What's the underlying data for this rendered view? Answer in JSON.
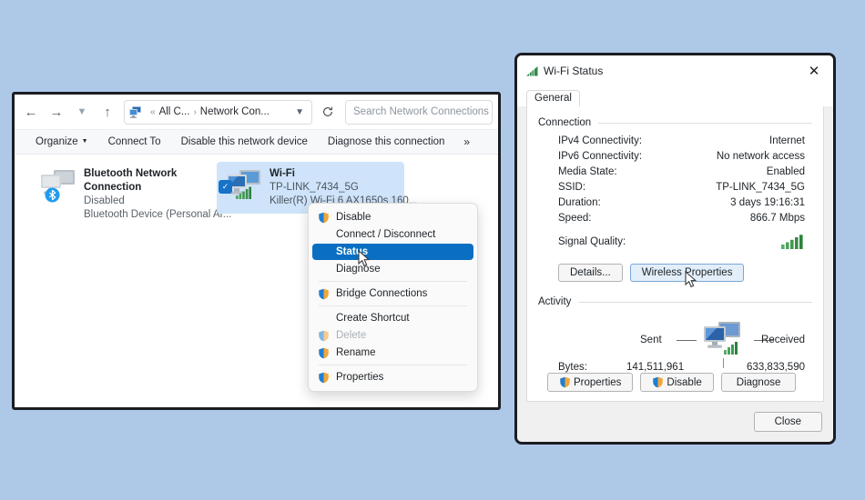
{
  "desktop": {
    "background_color": "#aec8e8"
  },
  "explorer": {
    "nav": {
      "back_icon": "arrow-left-icon",
      "forward_icon": "arrow-right-icon",
      "recent_icon": "chevron-down-icon",
      "up_icon": "arrow-up-icon",
      "refresh_icon": "refresh-icon"
    },
    "address": {
      "icon": "network-connections-icon",
      "separator_first": "«",
      "crumb1": "All C...",
      "crumb_sep": "›",
      "crumb2": "Network Con...",
      "chevron": "⌄"
    },
    "search": {
      "placeholder": "Search Network Connections",
      "value": ""
    },
    "commandbar": {
      "organize": "Organize",
      "connect_to": "Connect To",
      "disable_device": "Disable this network device",
      "diagnose": "Diagnose this connection",
      "more": "»"
    },
    "connections": [
      {
        "name": "Bluetooth Network Connection",
        "status": "Disabled",
        "device": "Bluetooth Device (Personal Ar...",
        "selected": false,
        "icon": "network-adapter-icon",
        "badge": "bluetooth-icon"
      },
      {
        "name": "Wi-Fi",
        "status": "TP-LINK_7434_5G",
        "device": "Killer(R) Wi-Fi 6 AX1650s 160...",
        "selected": true,
        "icon": "network-adapter-icon",
        "badge": "signal-bars-icon"
      }
    ]
  },
  "context_menu": {
    "items": [
      {
        "label": "Disable",
        "icon": "shield-icon",
        "selected": false,
        "disabled": false
      },
      {
        "label": "Connect / Disconnect",
        "icon": "",
        "selected": false,
        "disabled": false
      },
      {
        "label": "Status",
        "icon": "",
        "selected": true,
        "disabled": false
      },
      {
        "label": "Diagnose",
        "icon": "",
        "selected": false,
        "disabled": false
      },
      {
        "separator": true
      },
      {
        "label": "Bridge Connections",
        "icon": "shield-icon",
        "selected": false,
        "disabled": false
      },
      {
        "separator": true
      },
      {
        "label": "Create Shortcut",
        "icon": "",
        "selected": false,
        "disabled": false
      },
      {
        "label": "Delete",
        "icon": "shield-icon",
        "selected": false,
        "disabled": true
      },
      {
        "label": "Rename",
        "icon": "shield-icon",
        "selected": false,
        "disabled": false
      },
      {
        "separator": true
      },
      {
        "label": "Properties",
        "icon": "shield-icon",
        "selected": false,
        "disabled": false
      }
    ]
  },
  "wifi_status": {
    "title": "Wi-Fi Status",
    "title_icon": "signal-bars-icon",
    "close_icon": "close-icon",
    "tab": "General",
    "connection_group": "Connection",
    "fields": [
      {
        "label": "IPv4 Connectivity:",
        "value": "Internet"
      },
      {
        "label": "IPv6 Connectivity:",
        "value": "No network access"
      },
      {
        "label": "Media State:",
        "value": "Enabled"
      },
      {
        "label": "SSID:",
        "value": "TP-LINK_7434_5G"
      },
      {
        "label": "Duration:",
        "value": "3 days 19:16:31"
      },
      {
        "label": "Speed:",
        "value": "866.7 Mbps"
      }
    ],
    "signal_quality_label": "Signal Quality:",
    "signal_quality_icon": "signal-bars-icon",
    "signal_bars": 5,
    "details_button": "Details...",
    "wireless_properties_button": "Wireless Properties",
    "activity_group": "Activity",
    "sent_label": "Sent",
    "received_label": "Received",
    "activity_icon": "two-monitors-icon",
    "bytes_label": "Bytes:",
    "bytes_sent": "141,511,961",
    "bytes_received": "633,833,590",
    "properties_button": "Properties",
    "disable_button": "Disable",
    "diagnose_button": "Diagnose",
    "close_button": "Close"
  },
  "colors": {
    "selection_blue": "#cfe4fa",
    "menu_highlight": "#0a6fc2",
    "signal_green": "#3f9c52",
    "accent": "#1673c8"
  }
}
